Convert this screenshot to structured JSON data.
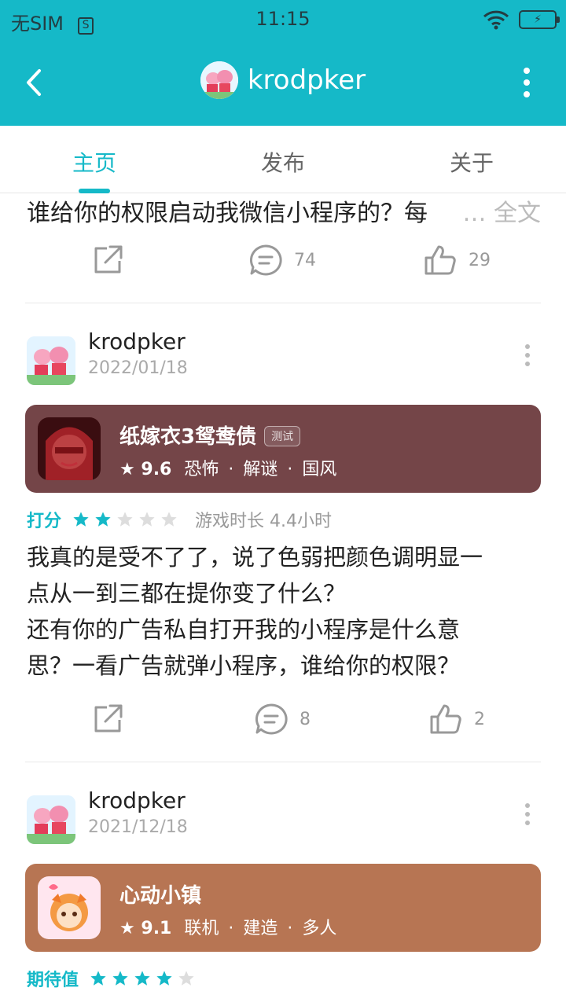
{
  "status": {
    "carrier": "无SIM",
    "sim_icon_text": "S",
    "time": "11:15",
    "battery_icon": "charging-battery-icon"
  },
  "header": {
    "title": "krodpker"
  },
  "tabs": [
    {
      "label": "主页"
    },
    {
      "label": "发布"
    },
    {
      "label": "关于"
    }
  ],
  "prev_post": {
    "excerpt": "谁给你的权限启动我微信小程序的？每",
    "more_label": "… 全文",
    "comments": "74",
    "likes": "29"
  },
  "posts": [
    {
      "user": "krodpker",
      "date": "2022/01/18",
      "game": {
        "name": "纸嫁衣3鸳鸯债",
        "badge": "测试",
        "score": "9.6",
        "tags": [
          "恐怖",
          "解谜",
          "国风"
        ],
        "color": "#744548"
      },
      "rating_label": "打分",
      "rating": 2,
      "playtime": "游戏时长 4.4小时",
      "body_lines": [
        "我真的是受不了了，说了色弱把颜色调明显一",
        "点从一到三都在提你变了什么？",
        "还有你的广告私自打开我的小程序是什么意",
        "思？一看广告就弹小程序，谁给你的权限？"
      ],
      "comments": "8",
      "likes": "2"
    },
    {
      "user": "krodpker",
      "date": "2021/12/18",
      "game": {
        "name": "心动小镇",
        "score": "9.1",
        "tags": [
          "联机",
          "建造",
          "多人"
        ],
        "color": "#b77553"
      },
      "rating_label": "期待值",
      "rating": 4
    }
  ],
  "colors": {
    "accent": "#15b9c8",
    "star_on": "#15b9c8",
    "star_off": "#dddddd"
  }
}
